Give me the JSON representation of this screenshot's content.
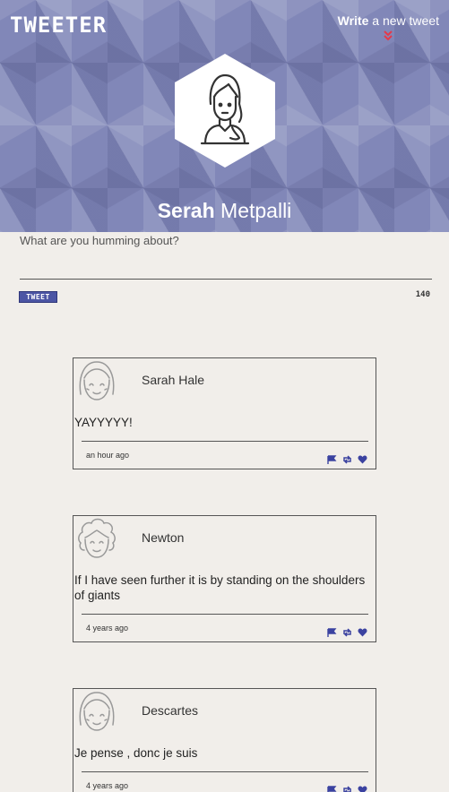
{
  "header": {
    "logo": "TWEETER",
    "write_bold": "Write",
    "write_rest": " a new tweet",
    "accent_color": "#e6394a"
  },
  "profile": {
    "first_name": "Serah",
    "last_name": " Metpalli",
    "avatar_icon": "woman-avatar-icon"
  },
  "compose": {
    "placeholder": "What are you humming about?",
    "value": "",
    "button_label": "TWEET",
    "char_count": "140"
  },
  "tweets": [
    {
      "author": "Sarah Hale",
      "text": "YAYYYYY!",
      "time": "an hour ago",
      "avatar_icon": "girl-avatar-icon"
    },
    {
      "author": "Newton",
      "text": "If I have seen further it is by standing on the shoulders of giants",
      "time": "4 years ago",
      "avatar_icon": "curly-hair-avatar-icon"
    },
    {
      "author": "Descartes",
      "text": "Je pense , donc je suis",
      "time": "4 years ago",
      "avatar_icon": "girl-avatar-icon"
    }
  ],
  "icons": {
    "flag": "flag-icon",
    "retweet": "retweet-icon",
    "like": "heart-icon"
  },
  "colors": {
    "header_bg": "#8187b8",
    "button_bg": "#4c55a4",
    "action_icons": "#3b42a0",
    "page_bg": "#f1eeea"
  }
}
